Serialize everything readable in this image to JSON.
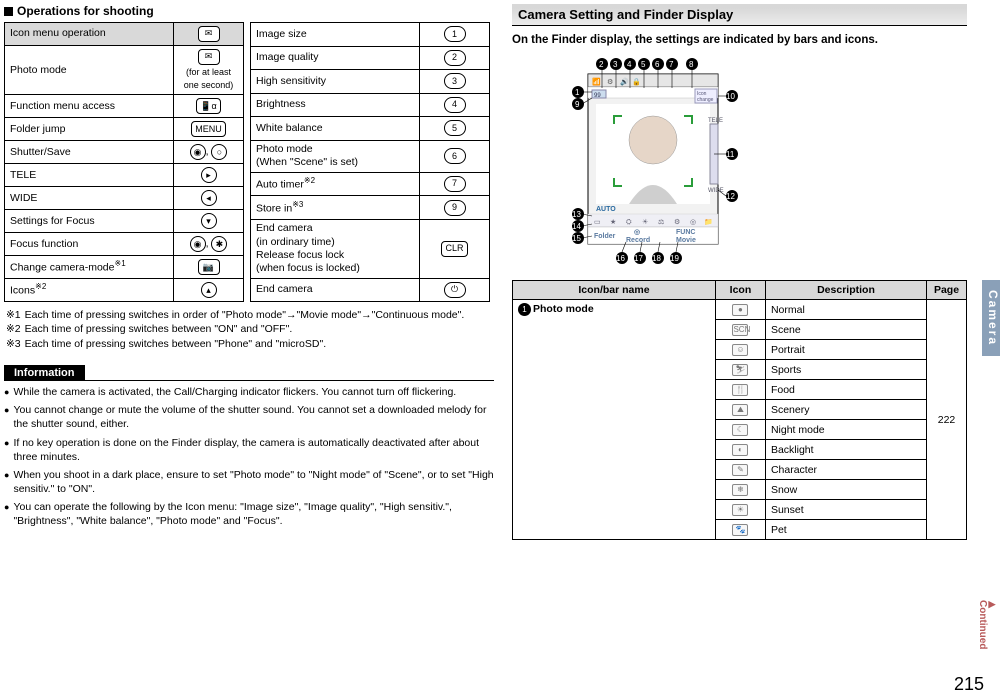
{
  "left": {
    "heading": "Operations for shooting",
    "table1_header_label": "Icon menu operation",
    "table1": [
      {
        "label": "Photo mode",
        "key": "mail",
        "note": "(for at least one second)"
      },
      {
        "label": "Function menu access",
        "key": "ir"
      },
      {
        "label": "Folder jump",
        "key": "MENU"
      },
      {
        "label": "Shutter/Save",
        "key": "center-circle"
      },
      {
        "label": "TELE",
        "key": "right"
      },
      {
        "label": "WIDE",
        "key": "left"
      },
      {
        "label": "Settings for Focus",
        "key": "down"
      },
      {
        "label": "Focus function",
        "key": "center-star"
      },
      {
        "label": "Change camera-mode",
        "ref": "※1",
        "key": "cam"
      },
      {
        "label": "Icons",
        "ref": "※2",
        "key": "up"
      }
    ],
    "table2": [
      {
        "label": "Image size",
        "key": "1"
      },
      {
        "label": "Image quality",
        "key": "2"
      },
      {
        "label": "High sensitivity",
        "key": "3"
      },
      {
        "label": "Brightness",
        "key": "4"
      },
      {
        "label": "White balance",
        "key": "5"
      },
      {
        "label": "Photo mode\n(When \"Scene\" is set)",
        "key": "6"
      },
      {
        "label": "Auto timer",
        "ref": "※2",
        "key": "7"
      },
      {
        "label": "Store in",
        "ref": "※3",
        "key": "9"
      },
      {
        "label": "End camera\n(in ordinary time)\nRelease focus lock\n(when focus is locked)",
        "key": "CLR"
      },
      {
        "label": "End camera",
        "key": "hangup"
      }
    ],
    "footnotes": [
      {
        "k": "※1",
        "t": "Each time of pressing switches in order of \"Photo mode\"→\"Movie mode\"→\"Continuous mode\"."
      },
      {
        "k": "※2",
        "t": "Each time of pressing switches between \"ON\" and \"OFF\"."
      },
      {
        "k": "※3",
        "t": "Each time of pressing switches between \"Phone\" and \"microSD\"."
      }
    ],
    "info_title": "Information",
    "info": [
      "While the camera is activated, the Call/Charging indicator flickers. You cannot turn off flickering.",
      "You cannot change or mute the volume of the shutter sound. You cannot set a downloaded melody for the shutter sound, either.",
      "If no key operation is done on the Finder display, the camera is automatically deactivated after about three minutes.",
      "When you shoot in a dark place, ensure to set \"Photo mode\" to \"Night mode\" of \"Scene\", or to set \"High sensitiv.\" to \"ON\".",
      "You can operate the following by the Icon menu: \"Image size\", \"Image quality\", \"High sensitiv.\", \"Brightness\", \"White balance\", \"Photo mode\" and \"Focus\"."
    ]
  },
  "right": {
    "heading": "Camera Setting and Finder Display",
    "lead": "On the Finder display, the settings are indicated by bars and icons.",
    "finder_labels": {
      "folder": "Folder",
      "record": "Record",
      "func": "FUNC",
      "movie": "Movie",
      "auto": "AUTO",
      "wide": "WIDE",
      "tele": "TELE",
      "icon_change": "Icon\nchange",
      "counter": "99"
    },
    "table_headers": {
      "c1": "Icon/bar name",
      "c2": "Icon",
      "c3": "Description",
      "c4": "Page"
    },
    "photo_mode_label": "Photo mode",
    "photo_mode_page": "222",
    "modes": [
      {
        "ico": "●",
        "name": "Normal"
      },
      {
        "ico": "SCN",
        "name": "Scene"
      },
      {
        "ico": "☺",
        "name": "Portrait"
      },
      {
        "ico": "⛷",
        "name": "Sports"
      },
      {
        "ico": "🍴",
        "name": "Food"
      },
      {
        "ico": "⛰",
        "name": "Scenery"
      },
      {
        "ico": "☾",
        "name": "Night mode"
      },
      {
        "ico": "◐",
        "name": "Backlight"
      },
      {
        "ico": "✎",
        "name": "Character"
      },
      {
        "ico": "❄",
        "name": "Snow"
      },
      {
        "ico": "☀",
        "name": "Sunset"
      },
      {
        "ico": "🐾",
        "name": "Pet"
      }
    ]
  },
  "side_tab": "Camera",
  "continued": "Continued",
  "page_number": "215"
}
